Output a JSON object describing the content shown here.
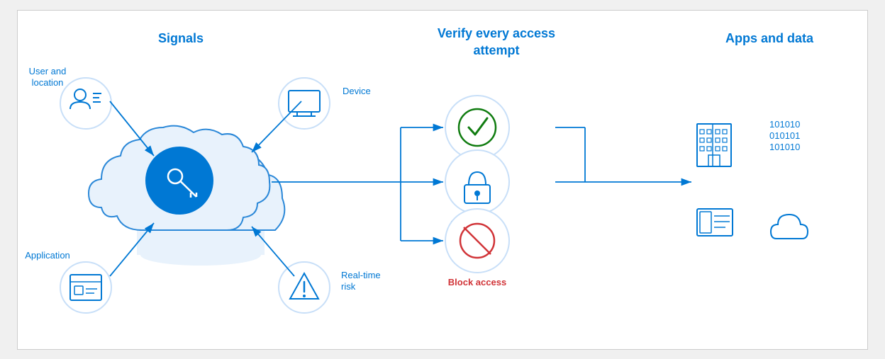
{
  "headers": {
    "signals": "Signals",
    "verify": "Verify every access attempt",
    "apps": "Apps and data"
  },
  "signals": {
    "user_location": "User and location",
    "device": "Device",
    "application": "Application",
    "realtime_risk": "Real-time risk"
  },
  "outcomes": {
    "allow": "Allow access",
    "mfa": "Require MFA",
    "block": "Block access"
  },
  "colors": {
    "blue": "#0078d4",
    "green": "#107c10",
    "red": "#d13438",
    "light_blue": "#c8dff8",
    "circle_border": "#2b88d8"
  }
}
